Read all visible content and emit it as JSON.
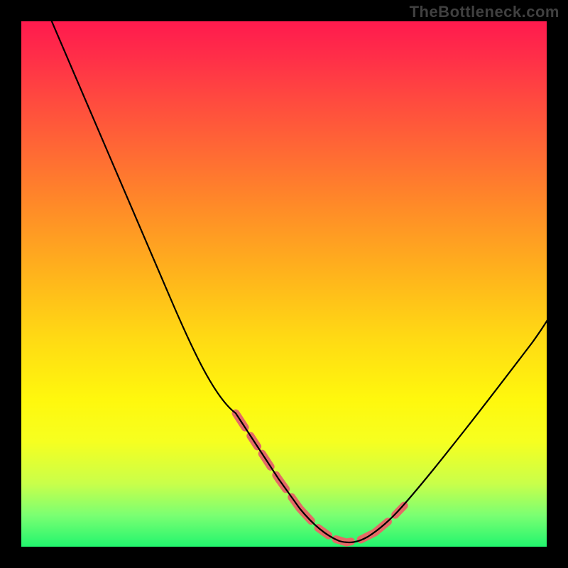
{
  "watermark": "TheBottleneck.com",
  "colors": {
    "page_bg": "#000000",
    "watermark_text": "#404040",
    "curve_line": "#000000",
    "highlight_stroke": "#e46a66",
    "gradient_stops": [
      "#ff1a4e",
      "#ff2f48",
      "#ff4a3f",
      "#ff6a34",
      "#ff8a28",
      "#ffb31c",
      "#ffd914",
      "#fff80d",
      "#f6ff20",
      "#c9ff4a",
      "#7bff72",
      "#22f56e"
    ]
  },
  "chart_data": {
    "type": "line",
    "title": "",
    "xlabel": "",
    "ylabel": "",
    "xlim": [
      0,
      100
    ],
    "ylim": [
      0,
      100
    ],
    "grid": false,
    "legend": false,
    "annotations": [
      "TheBottleneck.com"
    ],
    "series": [
      {
        "name": "bottleneck_curve",
        "x": [
          0,
          5,
          10,
          15,
          20,
          25,
          30,
          35,
          40,
          45,
          50,
          55,
          58,
          60,
          62,
          65,
          70,
          75,
          80,
          85,
          90,
          95,
          100
        ],
        "y": [
          105,
          96,
          87,
          78,
          69,
          60,
          51,
          42,
          33,
          24,
          15,
          7,
          3,
          1,
          0.5,
          1,
          4,
          11,
          20,
          29,
          38,
          47,
          55
        ]
      },
      {
        "name": "highlight_segment_left",
        "x": [
          40,
          45,
          50,
          55
        ],
        "y": [
          33,
          24,
          15,
          7
        ]
      },
      {
        "name": "highlight_segment_bottom",
        "x": [
          55,
          58,
          60,
          62,
          65
        ],
        "y": [
          7,
          3,
          1,
          0.5,
          1
        ]
      },
      {
        "name": "highlight_segment_right",
        "x": [
          65,
          70,
          73
        ],
        "y": [
          1,
          4,
          8
        ]
      }
    ],
    "note": "y-axis represents relative bottleneck severity (0 = no bottleneck / green, 100 = severe / red). No numeric axis labels are shown; values estimated from vertical gradient position. Highlight segments (salmon dashed) mark the near-minimum region of the curve."
  }
}
